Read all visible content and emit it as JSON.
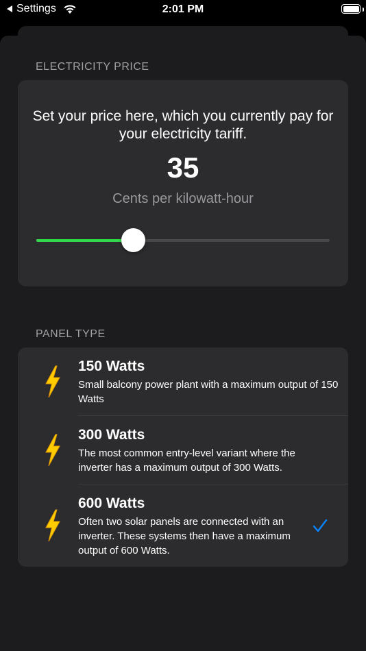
{
  "status_bar": {
    "back_label": "Settings",
    "time": "2:01 PM",
    "icons": [
      "back-arrow-icon",
      "wifi-icon",
      "battery-icon"
    ]
  },
  "electricity_price": {
    "header": "ELECTRICITY PRICE",
    "description": "Set your price here, which you currently pay for your electricity tariff.",
    "value": "35",
    "unit": "Cents per kilowatt-hour",
    "slider_fraction": 0.33
  },
  "panel_type": {
    "header": "PANEL TYPE",
    "items": [
      {
        "title": "150 Watts",
        "description": "Small balcony power plant with a maximum output of 150 Watts",
        "selected": false,
        "icon": "lightning-bolt-icon"
      },
      {
        "title": "300 Watts",
        "description": "The most common entry-level variant where the inverter has a maximum output of 300 Watts.",
        "selected": false,
        "icon": "lightning-bolt-icon"
      },
      {
        "title": "600 Watts",
        "description": "Often two solar panels are connected with an inverter. These systems then have a maximum output of 600 Watts.",
        "selected": true,
        "icon": "lightning-bolt-icon"
      }
    ]
  },
  "colors": {
    "background": "#000000",
    "sheet": "#1c1c1e",
    "card": "#2c2c2e",
    "slider_fill": "#32d74b",
    "checkmark": "#0a84ff",
    "bolt": "#ffcc00"
  }
}
